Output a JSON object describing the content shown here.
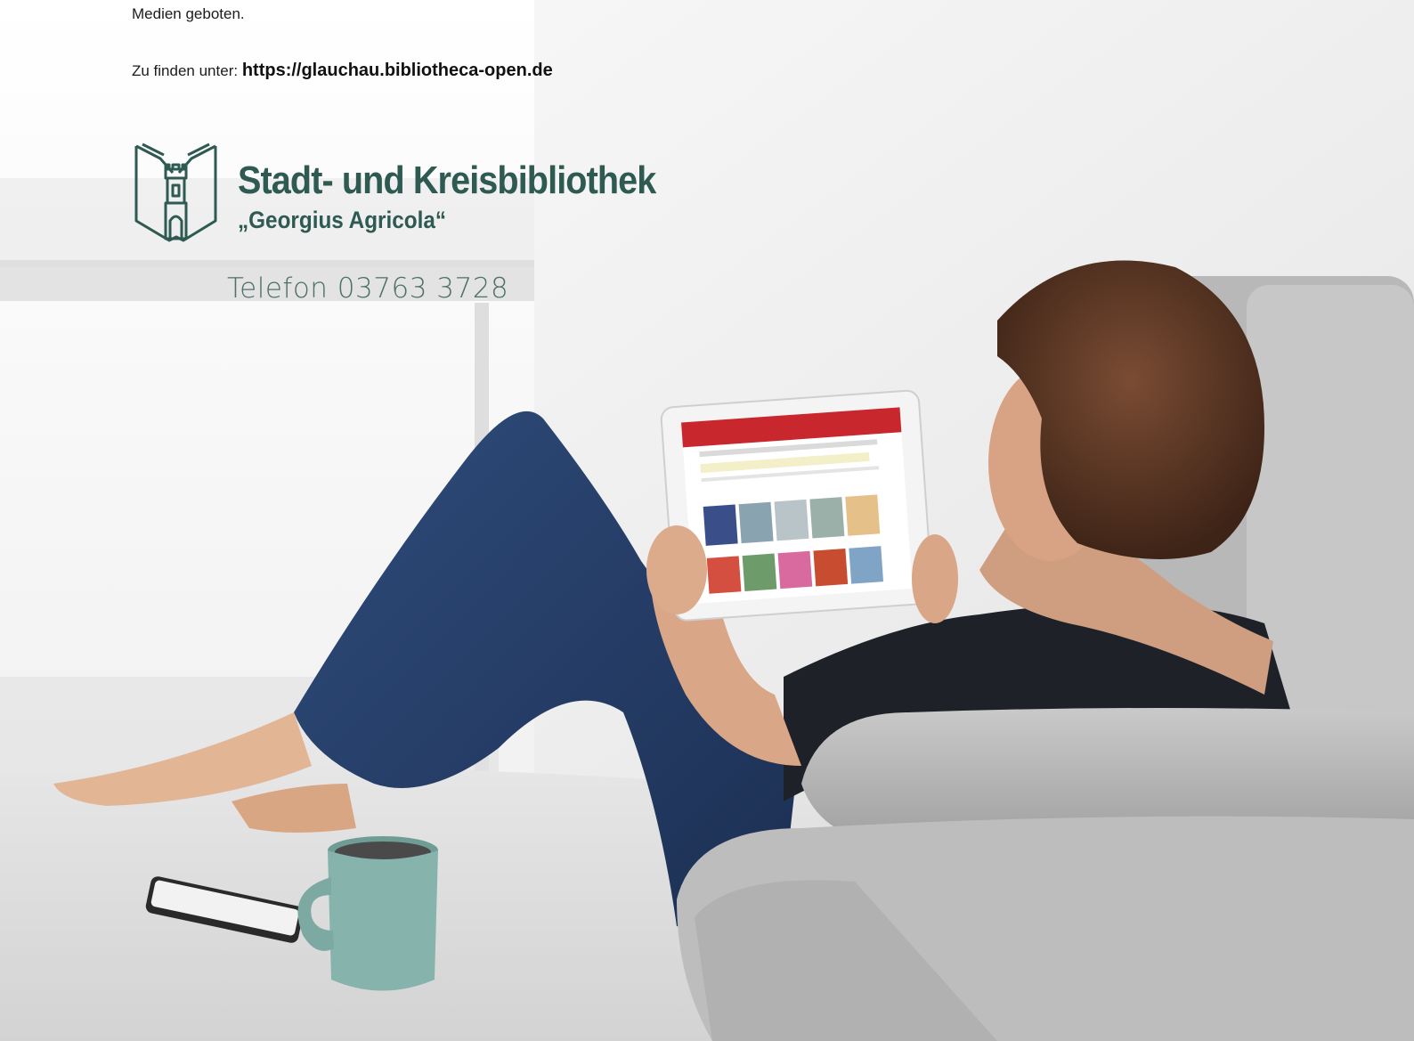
{
  "text": {
    "intro_tail": "Medien geboten.",
    "find_prefix": "Zu finden unter: ",
    "find_url": "https://glauchau.bibliotheca-open.de"
  },
  "logo": {
    "name": "Stadt- und Kreisbibliothek",
    "subtitle": "„Georgius Agricola“",
    "brand_color": "#2e5a52"
  },
  "contact": {
    "phone": "Telefon 03763 3728"
  },
  "photo": {
    "icon": "woman-reading-tablet-photo"
  }
}
